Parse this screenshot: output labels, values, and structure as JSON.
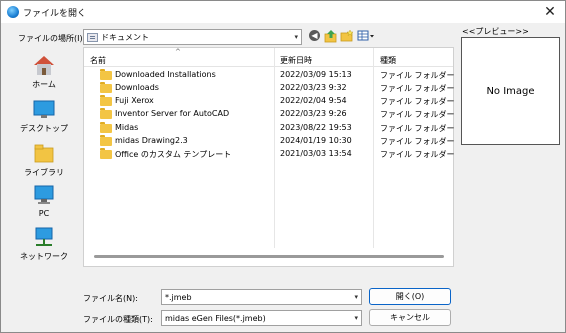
{
  "window": {
    "title": "ファイルを開く",
    "close_glyph": "✕"
  },
  "location": {
    "label": "ファイルの場所(I):",
    "value": "ドキュメント",
    "dropdown_glyph": "▾"
  },
  "toolbar": {
    "back_glyph": "◀",
    "icons": [
      "back-icon",
      "up-folder-icon",
      "new-folder-icon",
      "view-menu-icon"
    ]
  },
  "places": [
    {
      "label": "ホーム",
      "icon": "home-icon"
    },
    {
      "label": "デスクトップ",
      "icon": "desktop-icon"
    },
    {
      "label": "ライブラリ",
      "icon": "library-icon"
    },
    {
      "label": "PC",
      "icon": "pc-icon"
    },
    {
      "label": "ネットワーク",
      "icon": "network-icon"
    }
  ],
  "filelist": {
    "columns": [
      "名前",
      "更新日時",
      "種類"
    ],
    "sort_glyph": "^",
    "rows": [
      {
        "name": "Downloaded Installations",
        "date": "2022/03/09 15:13",
        "type": "ファイル フォルダー"
      },
      {
        "name": "Downloads",
        "date": "2022/03/23 9:32",
        "type": "ファイル フォルダー"
      },
      {
        "name": "Fuji Xerox",
        "date": "2022/02/04 9:54",
        "type": "ファイル フォルダー"
      },
      {
        "name": "Inventor Server for AutoCAD",
        "date": "2022/03/23 9:26",
        "type": "ファイル フォルダー"
      },
      {
        "name": "Midas",
        "date": "2023/08/22 19:53",
        "type": "ファイル フォルダー"
      },
      {
        "name": "midas Drawing2.3",
        "date": "2024/01/19 10:30",
        "type": "ファイル フォルダー"
      },
      {
        "name": "Office のカスタム テンプレート",
        "date": "2021/03/03 13:54",
        "type": "ファイル フォルダー"
      }
    ]
  },
  "preview": {
    "label": "<<プレビュー>>",
    "placeholder": "No Image"
  },
  "filename": {
    "label": "ファイル名(N):",
    "value": "*.jmeb",
    "dropdown_glyph": "▾"
  },
  "filetype": {
    "label": "ファイルの種類(T):",
    "value": "midas eGen Files(*.jmeb)",
    "dropdown_glyph": "▾"
  },
  "buttons": {
    "open": "開く(O)",
    "cancel": "キャンセル"
  }
}
